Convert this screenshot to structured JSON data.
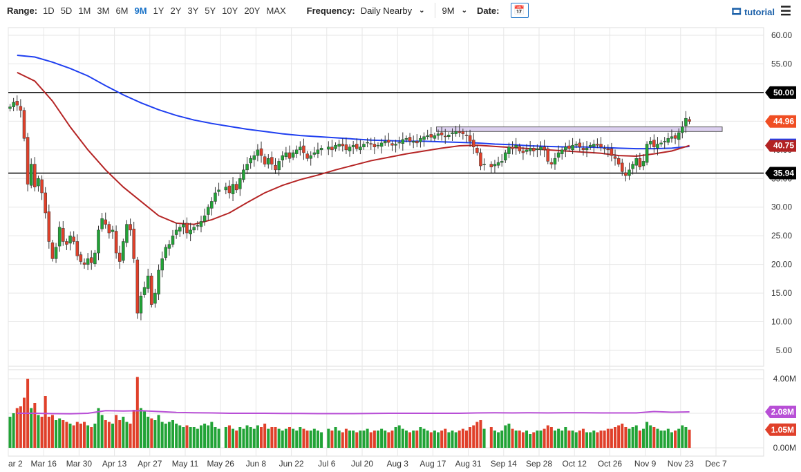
{
  "toolbar": {
    "range_label": "Range:",
    "ranges": [
      "1D",
      "5D",
      "1M",
      "3M",
      "6M",
      "9M",
      "1Y",
      "2Y",
      "3Y",
      "5Y",
      "10Y",
      "20Y",
      "MAX"
    ],
    "active_range": "9M",
    "frequency_label": "Frequency:",
    "frequency_value": "Daily Nearby",
    "period_value": "9M",
    "date_label": "Date:",
    "tutorial_label": "tutorial"
  },
  "colors": {
    "up": "#21a336",
    "down": "#e0402a",
    "ma_long": "#1f3ff0",
    "ma_short": "#b52424",
    "vol_ma": "#b84fd6",
    "zone": "#dcd0f0"
  },
  "chart_data": {
    "type": "candlestick",
    "price_axis": {
      "min": 5,
      "max": 60,
      "step": 5,
      "labels": [
        "60.00",
        "55.00",
        "50.00",
        "45.00",
        "40.00",
        "35.00",
        "30.00",
        "25.00",
        "20.00",
        "15.00",
        "10.00",
        "5.00"
      ]
    },
    "volume_axis": {
      "min": 0,
      "max": 4,
      "labels": [
        "4.00M",
        "2.00M",
        "0.00M"
      ]
    },
    "x_ticks": [
      {
        "label": "ar 2",
        "week": 0
      },
      {
        "label": "Mar 16",
        "week": 2
      },
      {
        "label": "Mar 30",
        "week": 4
      },
      {
        "label": "Apr 13",
        "week": 6
      },
      {
        "label": "Apr 27",
        "week": 8
      },
      {
        "label": "May 11",
        "week": 10
      },
      {
        "label": "May 26",
        "week": 12
      },
      {
        "label": "Jun 8",
        "week": 14
      },
      {
        "label": "Jun 22",
        "week": 16
      },
      {
        "label": "Jul 6",
        "week": 18
      },
      {
        "label": "Jul 20",
        "week": 20
      },
      {
        "label": "Aug 3",
        "week": 22
      },
      {
        "label": "Aug 17",
        "week": 24
      },
      {
        "label": "Aug 31",
        "week": 26
      },
      {
        "label": "Sep 14",
        "week": 28
      },
      {
        "label": "Sep 28",
        "week": 30
      },
      {
        "label": "Oct 12",
        "week": 32
      },
      {
        "label": "Oct 26",
        "week": 34
      },
      {
        "label": "Nov 9",
        "week": 36
      },
      {
        "label": "Nov 23",
        "week": 38
      },
      {
        "label": "Dec 7",
        "week": 40
      }
    ],
    "weeks": [
      {
        "c": [
          47.5,
          48.3,
          47.8,
          46.9,
          42.0
        ],
        "v": [
          1.8,
          2.0,
          2.3,
          2.4,
          2.9
        ]
      },
      {
        "c": [
          34,
          37.5,
          33.5,
          35,
          32.5
        ],
        "v": [
          4.0,
          2.3,
          2.6,
          1.9,
          1.8
        ]
      },
      {
        "c": [
          29,
          24,
          21,
          23,
          26.5
        ],
        "v": [
          3.0,
          1.8,
          1.9,
          1.6,
          1.7
        ]
      },
      {
        "c": [
          24,
          23.5,
          25,
          24,
          21.5
        ],
        "v": [
          1.6,
          1.5,
          1.4,
          1.3,
          1.5
        ]
      },
      {
        "c": [
          20.5,
          20,
          21,
          20.3,
          22
        ],
        "v": [
          1.4,
          1.5,
          1.3,
          1.2,
          1.4
        ]
      },
      {
        "c": [
          26,
          28,
          27,
          25.5,
          26
        ],
        "v": [
          2.3,
          1.9,
          1.6,
          1.5,
          1.4
        ]
      },
      {
        "c": [
          22,
          20.5,
          24,
          27,
          26
        ],
        "v": [
          1.9,
          1.6,
          1.8,
          1.5,
          1.4
        ]
      },
      {
        "c": [
          21,
          11.5,
          14.5,
          16,
          18
        ],
        "v": [
          2.2,
          4.1,
          2.3,
          2.1,
          1.8
        ]
      },
      {
        "c": [
          13,
          15,
          19,
          21,
          23
        ],
        "v": [
          1.7,
          1.6,
          1.9,
          1.5,
          1.4
        ]
      },
      {
        "c": [
          23.5,
          25,
          26,
          26.5,
          27
        ],
        "v": [
          1.5,
          1.6,
          1.4,
          1.3,
          1.2
        ]
      },
      {
        "c": [
          25.5,
          26,
          26.5,
          26.8,
          27.5
        ],
        "v": [
          1.3,
          1.2,
          1.2,
          1.1,
          1.3
        ]
      },
      {
        "c": [
          28.5,
          30,
          31,
          32.5,
          33
        ],
        "v": [
          1.4,
          1.3,
          1.5,
          1.2,
          1.1
        ]
      },
      {
        "c": [
          null,
          33.5,
          32.5,
          34,
          33
        ],
        "v": [
          null,
          1.2,
          1.3,
          1.1,
          1.0
        ]
      },
      {
        "c": [
          35,
          36.5,
          37.5,
          38.5,
          39
        ],
        "v": [
          1.2,
          1.1,
          1.3,
          1.2,
          1.1
        ]
      },
      {
        "c": [
          40,
          39,
          37.5,
          38.5,
          37.5
        ],
        "v": [
          1.3,
          1.2,
          1.4,
          1.1,
          1.2
        ]
      },
      {
        "c": [
          36.5,
          38,
          39,
          39.5,
          38.5
        ],
        "v": [
          1.2,
          1.1,
          1.0,
          1.1,
          1.2
        ]
      },
      {
        "c": [
          39.5,
          40,
          40.5,
          39.5,
          38.5
        ],
        "v": [
          1.1,
          1.0,
          1.2,
          1.1,
          1.0
        ]
      },
      {
        "c": [
          39,
          39.5,
          40,
          40.3,
          null
        ],
        "v": [
          1.0,
          1.1,
          1.0,
          0.9,
          null
        ]
      },
      {
        "c": [
          40.5,
          40,
          40.8,
          41,
          40.7
        ],
        "v": [
          1.1,
          1.0,
          1.2,
          1.0,
          0.9
        ]
      },
      {
        "c": [
          40,
          40.5,
          40.8,
          40.2,
          40.5
        ],
        "v": [
          1.1,
          1.0,
          1.0,
          0.9,
          1.0
        ]
      },
      {
        "c": [
          41,
          41.3,
          41,
          40.5,
          40.8
        ],
        "v": [
          1.0,
          1.1,
          0.9,
          1.0,
          1.0
        ]
      },
      {
        "c": [
          41.2,
          41.5,
          41.3,
          40.8,
          41
        ],
        "v": [
          1.1,
          1.0,
          0.9,
          1.0,
          1.2
        ]
      },
      {
        "c": [
          41.3,
          41.8,
          42,
          41.5,
          41.5
        ],
        "v": [
          1.3,
          1.1,
          1.0,
          0.9,
          1.0
        ]
      },
      {
        "c": [
          41.2,
          42,
          42.3,
          42.5,
          42.2
        ],
        "v": [
          1.0,
          1.2,
          1.1,
          1.0,
          0.9
        ]
      },
      {
        "c": [
          42.5,
          42.8,
          42.6,
          42.3,
          42.6
        ],
        "v": [
          1.0,
          0.9,
          1.0,
          1.1,
          0.9
        ]
      },
      {
        "c": [
          43,
          43.2,
          43,
          42.8,
          42.5
        ],
        "v": [
          1.0,
          0.9,
          1.0,
          1.1,
          1.0
        ]
      },
      {
        "c": [
          41.5,
          40.5,
          39.5,
          37.2,
          37.5
        ],
        "v": [
          1.2,
          1.3,
          1.5,
          1.6,
          1.1
        ]
      },
      {
        "c": [
          null,
          37,
          37.5,
          37.8,
          38
        ],
        "v": [
          null,
          1.2,
          1.0,
          0.9,
          1.0
        ]
      },
      {
        "c": [
          39.5,
          40.5,
          40.2,
          40.8,
          39.8
        ],
        "v": [
          1.3,
          1.4,
          1.1,
          1.0,
          1.0
        ]
      },
      {
        "c": [
          39.5,
          40,
          40.3,
          39.8,
          40.2
        ],
        "v": [
          0.9,
          1.0,
          0.8,
          0.9,
          1.0
        ]
      },
      {
        "c": [
          40.5,
          40,
          38,
          37.5,
          38.5
        ],
        "v": [
          1.0,
          1.1,
          1.3,
          1.2,
          1.0
        ]
      },
      {
        "c": [
          39.5,
          40,
          40.5,
          40.2,
          40.8
        ],
        "v": [
          1.1,
          1.0,
          1.2,
          1.0,
          1.0
        ]
      },
      {
        "c": [
          41,
          40.5,
          40,
          40.3,
          40.8
        ],
        "v": [
          0.9,
          1.0,
          1.1,
          0.9,
          0.9
        ]
      },
      {
        "c": [
          41,
          40.8,
          40.5,
          40.2,
          40
        ],
        "v": [
          1.0,
          0.9,
          1.0,
          1.0,
          1.1
        ]
      },
      {
        "c": [
          39,
          38.5,
          37.5,
          36.2,
          35.5
        ],
        "v": [
          1.1,
          1.2,
          1.3,
          1.4,
          1.2
        ]
      },
      {
        "c": [
          36.5,
          37.5,
          38.5,
          37,
          38
        ],
        "v": [
          1.1,
          1.2,
          1.3,
          1.0,
          1.1
        ]
      },
      {
        "c": [
          41,
          41.5,
          40.5,
          41,
          41.2
        ],
        "v": [
          1.5,
          1.3,
          1.2,
          1.1,
          1.0
        ]
      },
      {
        "c": [
          41.5,
          42,
          42.3,
          42,
          43
        ],
        "v": [
          1.0,
          1.1,
          0.9,
          1.0,
          1.1
        ]
      },
      {
        "c": [
          44,
          45.5,
          44.96
        ],
        "v": [
          1.3,
          1.2,
          1.05
        ]
      }
    ],
    "ma_long_weekly": [
      56.5,
      56.2,
      55.3,
      54.2,
      52.9,
      51.2,
      49.6,
      48.2,
      47.0,
      46.0,
      45.2,
      44.6,
      44.1,
      43.6,
      43.2,
      42.8,
      42.5,
      42.3,
      42.1,
      41.9,
      41.7,
      41.6,
      41.5,
      41.5,
      41.4,
      41.3,
      41.2,
      41.0,
      40.9,
      40.7,
      40.6,
      40.5,
      40.5,
      40.4,
      40.3,
      40.2,
      40.2,
      40.3,
      40.6
    ],
    "ma_short_weekly": [
      53.5,
      52.0,
      48.5,
      44,
      40,
      36.5,
      33.5,
      31,
      28.5,
      27.2,
      27.0,
      27.8,
      29,
      30.8,
      32.5,
      33.8,
      34.8,
      35.6,
      36.5,
      37.3,
      38.1,
      38.7,
      39.3,
      39.8,
      40.3,
      40.7,
      40.8,
      40.6,
      40.4,
      40.2,
      40.0,
      39.8,
      39.6,
      39.4,
      39.0,
      38.9,
      39.3,
      39.8,
      40.75
    ],
    "volume_ma_weekly": [
      2.0,
      2.0,
      1.98,
      1.97,
      2.0,
      2.15,
      2.13,
      2.15,
      2.1,
      2.05,
      2.03,
      2.02,
      2.0,
      2.0,
      2.0,
      1.99,
      1.99,
      1.98,
      1.98,
      1.98,
      1.99,
      2.0,
      2.0,
      2.0,
      2.0,
      2.0,
      2.02,
      2.03,
      2.02,
      2.03,
      2.02,
      2.03,
      2.03,
      2.02,
      2.02,
      2.02,
      2.1,
      2.06,
      2.08
    ],
    "horizontal_lines": [
      50.0,
      35.94
    ],
    "resistance_zone": {
      "low": 43.2,
      "high": 44.0,
      "start_week": 24.2
    },
    "badges": [
      {
        "text": "50.00",
        "value": 50.0,
        "color": "#000000",
        "panel": "price"
      },
      {
        "text": "44.96",
        "value": 44.96,
        "color": "#f04e23",
        "panel": "price"
      },
      {
        "text": "40.75",
        "value": 40.75,
        "color": "#b22222",
        "panel": "price"
      },
      {
        "text": "35.94",
        "value": 35.94,
        "color": "#000000",
        "panel": "price"
      },
      {
        "text": "2.08M",
        "value": 2.08,
        "color": "#b84fd6",
        "panel": "volume"
      },
      {
        "text": "1.05M",
        "value": 1.05,
        "color": "#e0402a",
        "panel": "volume"
      }
    ]
  }
}
